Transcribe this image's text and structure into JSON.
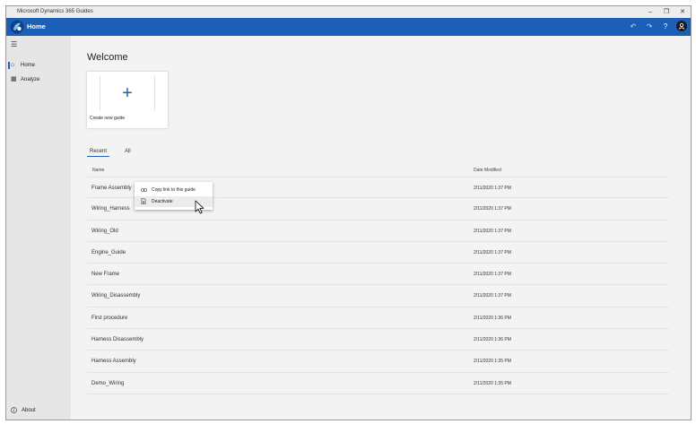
{
  "window": {
    "title": "Microsoft Dynamics 365 Guides",
    "controls": [
      "–",
      "❐",
      "✕"
    ]
  },
  "appbar": {
    "title": "Home",
    "icons": [
      "undo-icon",
      "redo-icon",
      "help-icon",
      "account-icon"
    ],
    "undo": "↶",
    "redo": "↷",
    "help": "?",
    "accent": "#1d5fb7"
  },
  "sidebar": {
    "items": [
      {
        "label": "Home",
        "icon": "home-icon",
        "glyph": "⌂"
      },
      {
        "label": "Analyze",
        "icon": "analyze-icon",
        "glyph": "▦"
      }
    ],
    "about": "About"
  },
  "main": {
    "heading": "Welcome",
    "create_label": "Create new guide",
    "tabs": [
      "Recent",
      "All"
    ],
    "columns": {
      "name": "Name",
      "date": "Date Modified"
    },
    "rows": [
      {
        "name": "Frame Assembly",
        "date": "2/11/2020 1:37 PM"
      },
      {
        "name": "Wiring_Harness",
        "date": "2/11/2020 1:37 PM"
      },
      {
        "name": "Wiring_Old",
        "date": "2/11/2020 1:37 PM"
      },
      {
        "name": "Engine_Guide",
        "date": "2/11/2020 1:37 PM"
      },
      {
        "name": "New Frame",
        "date": "2/11/2020 1:37 PM"
      },
      {
        "name": "Wiring_Disassembly",
        "date": "2/11/2020 1:37 PM"
      },
      {
        "name": "First procedure",
        "date": "2/11/2020 1:36 PM"
      },
      {
        "name": "Harness Disassembly",
        "date": "2/11/2020 1:36 PM"
      },
      {
        "name": "Harness Assembly",
        "date": "2/11/2020 1:35 PM"
      },
      {
        "name": "Demo_Wiring",
        "date": "2/11/2020 1:35 PM"
      }
    ]
  },
  "context_menu": {
    "items": [
      {
        "label": "Copy link to this guide",
        "icon": "link-icon"
      },
      {
        "label": "Deactivate",
        "icon": "deactivate-icon"
      }
    ]
  }
}
